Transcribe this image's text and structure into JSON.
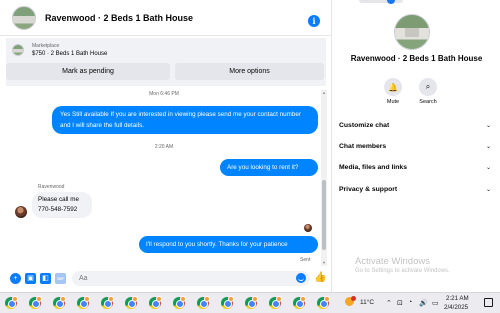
{
  "chat": {
    "header_title": "Ravenwood · 2 Beds 1 Bath House",
    "info_glyph": "i",
    "marketplace": {
      "label": "Marketplace",
      "price_title": "$750 · 2 Beds 1 Bath House",
      "pending_label": "Mark as pending",
      "options_label": "More options"
    },
    "messages": {
      "ts1": "Mon 6:46 PM",
      "out1": "Yes Still available If you are interested in viewing please send me your contact number and I will share the full details.",
      "ts2": "2:20 AM",
      "out2": "Are you looking to rent it?",
      "sender": "Ravenwood",
      "in1": "Please call me 770-548-7592",
      "out3": "I'll respond to you shortly. Thanks for your patience",
      "sent": "Sent"
    },
    "composer": {
      "placeholder": "Aa",
      "like_glyph": "👍"
    }
  },
  "details": {
    "title": "Ravenwood · 2 Beds 1 Bath House",
    "actions": [
      {
        "label": "Mute",
        "icon": "bell-icon",
        "glyph": "🔔"
      },
      {
        "label": "Search",
        "icon": "search-icon",
        "glyph": "⌕"
      }
    ],
    "sections": [
      "Customize chat",
      "Chat members",
      "Media, files and links",
      "Privacy & support"
    ],
    "chevron": "⌄",
    "watermark_title": "Activate Windows",
    "watermark_sub": "Go to Settings to activate Windows."
  },
  "taskbar": {
    "apps_count_label": "",
    "temperature": "11°C",
    "tray": {
      "chevron": "⌃",
      "network": "⊡",
      "wifi": "◔",
      "volume": "🔊",
      "battery": "▭"
    },
    "time": "2:21 AM",
    "date": "2/4/2025"
  },
  "colors": {
    "accent": "#0084ff",
    "incoming_bubble": "#f0f2f5",
    "taskbar": "#ecebf0"
  }
}
